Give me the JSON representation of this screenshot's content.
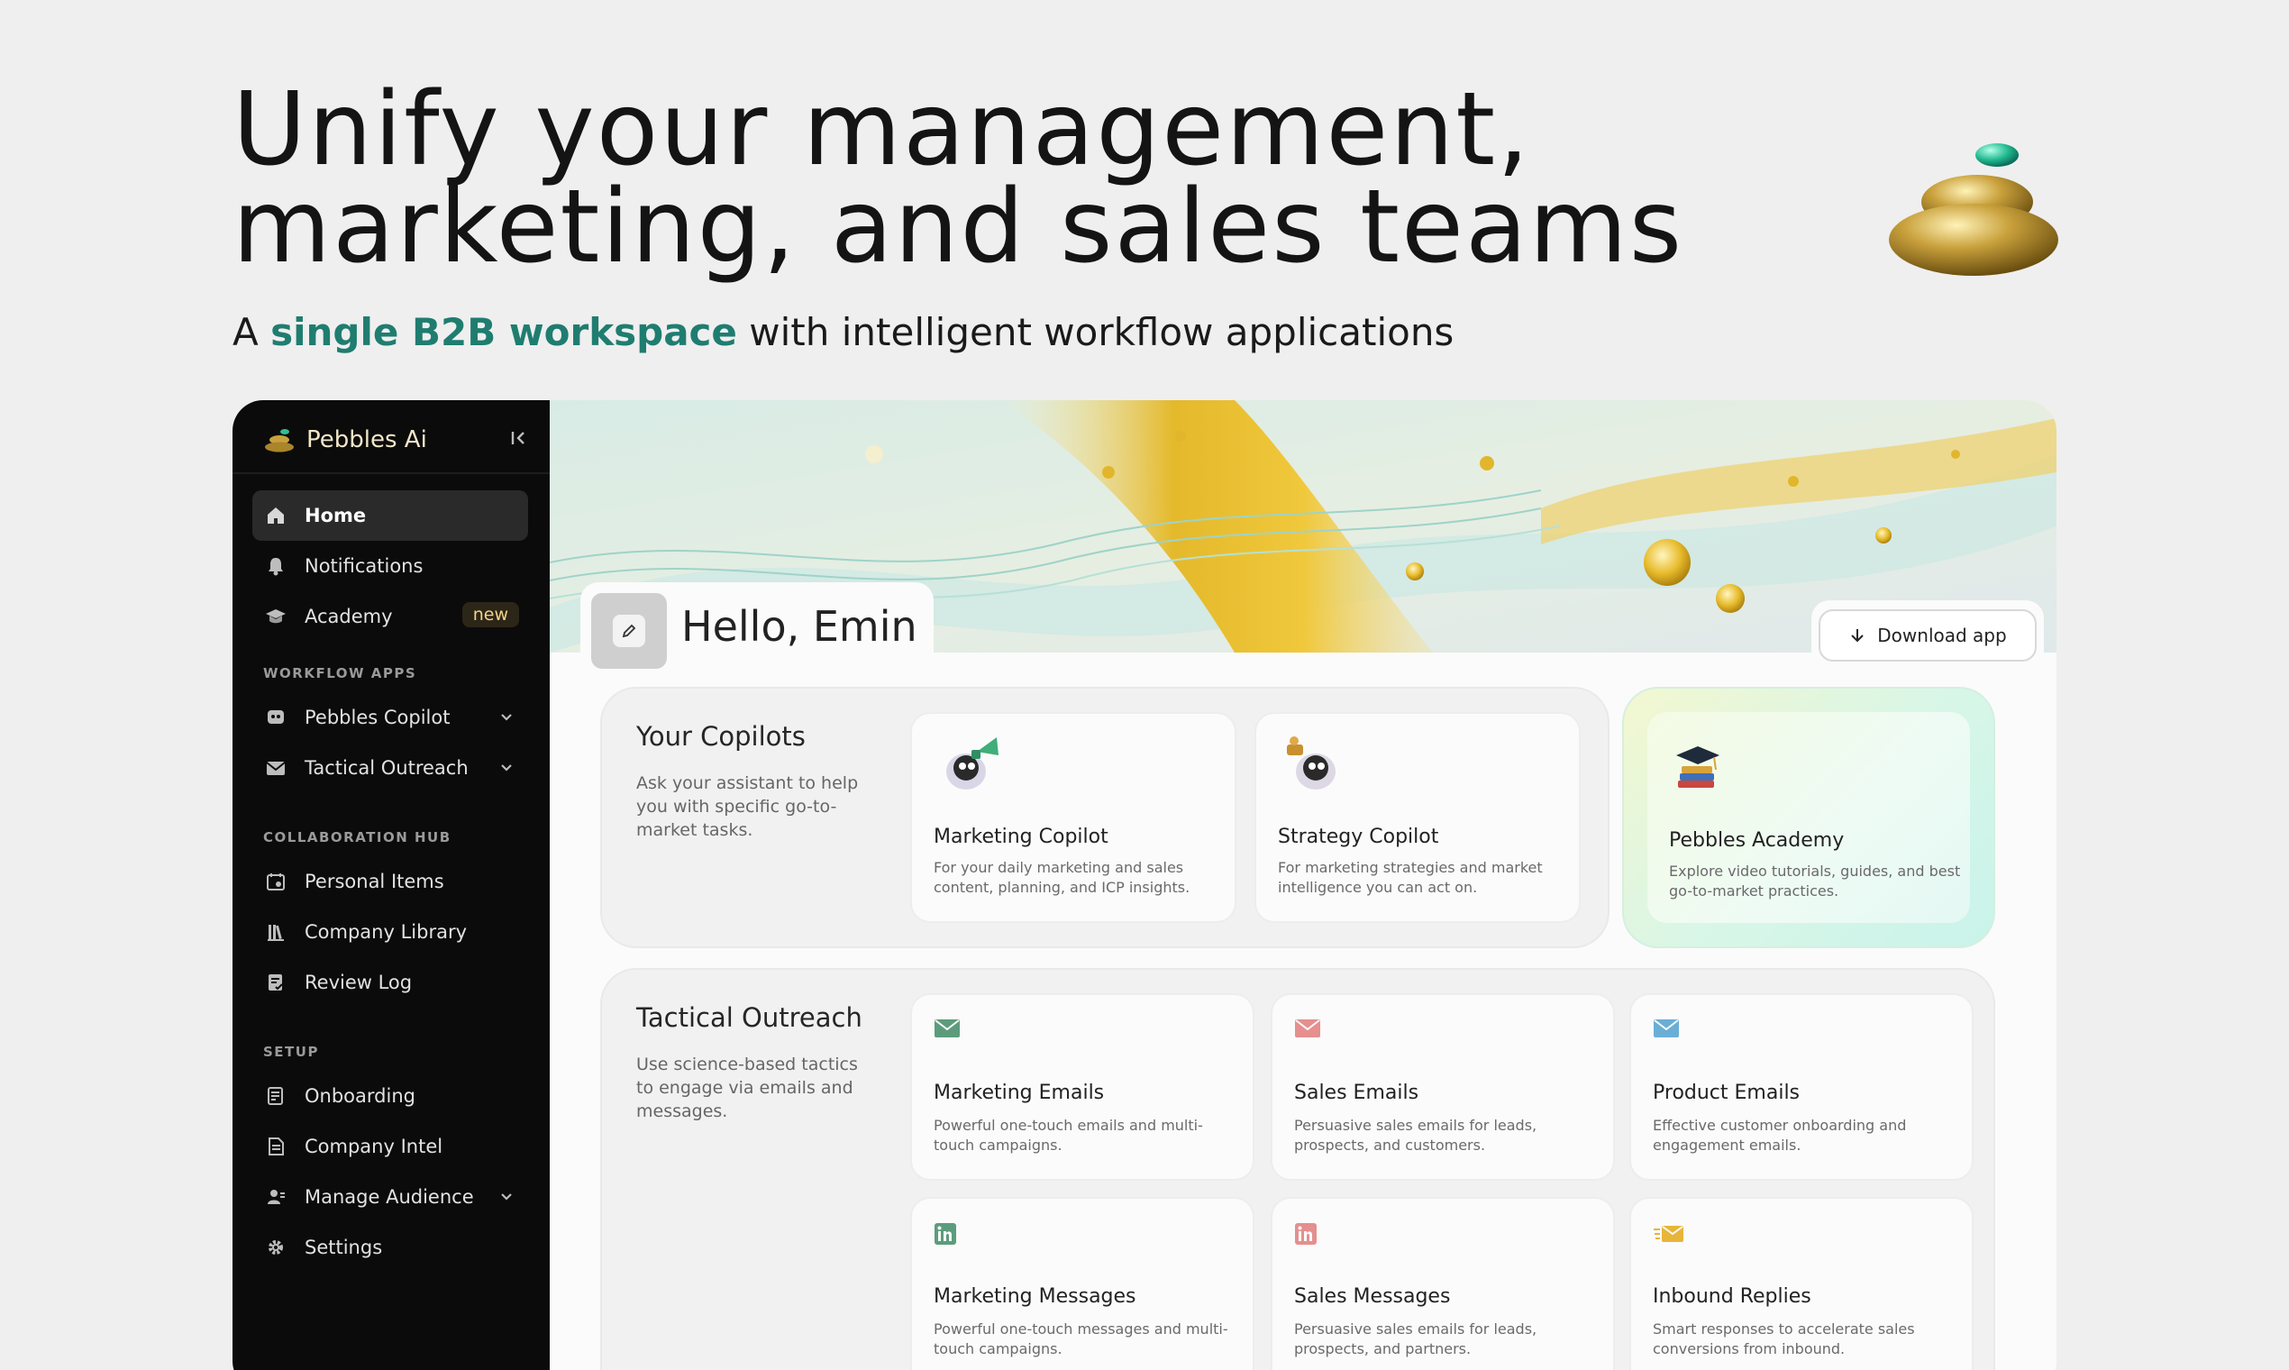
{
  "hero": {
    "title_line1": "Unify your management,",
    "title_line2": "marketing, and sales teams",
    "subtitle_prefix": "A ",
    "subtitle_accent": "single B2B workspace",
    "subtitle_suffix": " with intelligent workflow applications"
  },
  "colors": {
    "accent": "#1f7d70",
    "sidebar_bg": "#0b0b0b",
    "badge_text": "#f1d488"
  },
  "sidebar": {
    "brand": "Pebbles Ai",
    "items": [
      {
        "label": "Home",
        "icon": "home-icon",
        "active": true
      },
      {
        "label": "Notifications",
        "icon": "bell-icon"
      },
      {
        "label": "Academy",
        "icon": "graduation-cap-icon",
        "badge": "new"
      }
    ],
    "sections": [
      {
        "label": "WORKFLOW APPS",
        "items": [
          {
            "label": "Pebbles Copilot",
            "icon": "robot-icon"
          },
          {
            "label": "Tactical Outreach",
            "icon": "mail-icon"
          }
        ]
      },
      {
        "label": "COLLABORATION HUB",
        "items": [
          {
            "label": "Personal Items",
            "icon": "calendar-icon"
          },
          {
            "label": "Company Library",
            "icon": "library-icon"
          },
          {
            "label": "Review Log",
            "icon": "review-icon"
          }
        ]
      },
      {
        "label": "SETUP",
        "items": [
          {
            "label": "Onboarding",
            "icon": "onboarding-icon"
          },
          {
            "label": "Company Intel",
            "icon": "document-icon"
          },
          {
            "label": "Manage Audience",
            "icon": "audience-icon"
          },
          {
            "label": "Settings",
            "icon": "gear-icon"
          }
        ]
      }
    ]
  },
  "main": {
    "greeting": "Hello, Emin",
    "download_label": "Download app",
    "copilots": {
      "title": "Your Copilots",
      "description": "Ask your assistant to help you with specific go-to-market tasks.",
      "cards": [
        {
          "title": "Marketing Copilot",
          "desc": "For your daily marketing and sales content, planning, and ICP insights."
        },
        {
          "title": "Strategy Copilot",
          "desc": "For marketing strategies and market intelligence you can act on."
        },
        {
          "title": "Pebbles Academy",
          "desc": "Explore video tutorials, guides, and best go-to-market practices."
        }
      ]
    },
    "outreach": {
      "title": "Tactical Outreach",
      "description": "Use science-based tactics to engage via emails and messages.",
      "cards": [
        {
          "title": "Marketing Emails",
          "desc": "Powerful one-touch emails and multi-touch campaigns.",
          "icon": "mail-icon",
          "color": "#5c9c7c"
        },
        {
          "title": "Sales Emails",
          "desc": "Persuasive sales emails for leads, prospects, and customers.",
          "icon": "mail-icon",
          "color": "#e58f8f"
        },
        {
          "title": "Product Emails",
          "desc": "Effective customer onboarding and engagement emails.",
          "icon": "mail-icon",
          "color": "#6aaed6"
        },
        {
          "title": "Marketing Messages",
          "desc": "Powerful one-touch messages and multi-touch campaigns.",
          "icon": "linkedin-icon",
          "color": "#5c9c7c"
        },
        {
          "title": "Sales Messages",
          "desc": "Persuasive sales emails for leads, prospects, and partners.",
          "icon": "linkedin-icon",
          "color": "#e58f8f"
        },
        {
          "title": "Inbound Replies",
          "desc": "Smart responses to accelerate sales conversions from inbound.",
          "icon": "fast-mail-icon",
          "color": "#e7b53a"
        }
      ]
    }
  }
}
